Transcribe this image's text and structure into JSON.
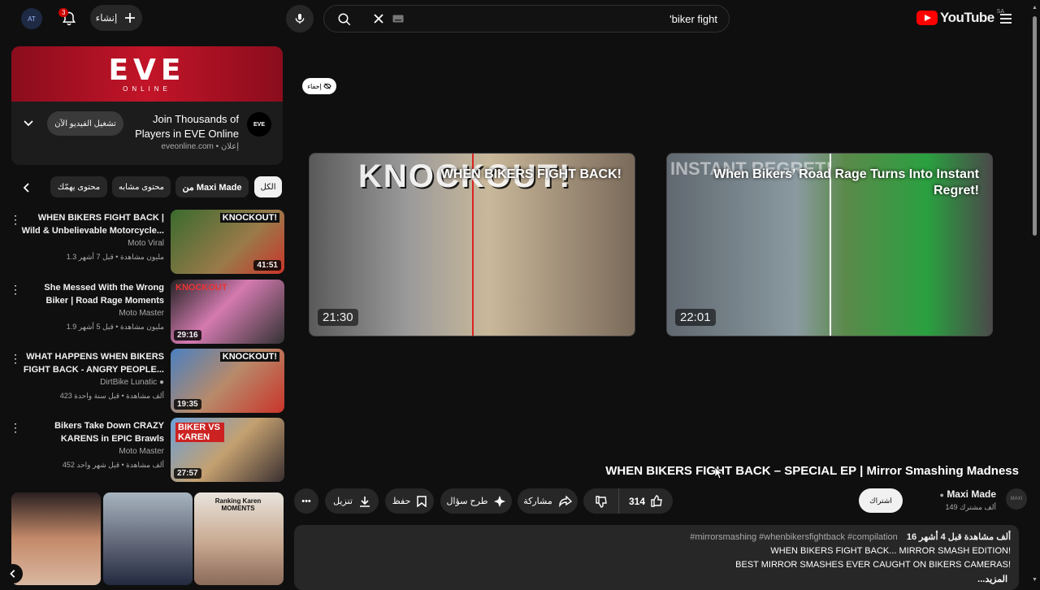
{
  "topbar": {
    "logo_text": "YouTube",
    "country_code": "SA",
    "search_query": "'biker fight",
    "create_label": "إنشاء",
    "notification_count": "3",
    "avatar_initials": "AT"
  },
  "ad": {
    "brand_logo": "EVE",
    "brand_logo_sub": "ONLINE",
    "title": "Join Thousands of Players in EVE Online",
    "ad_label": "إعلان",
    "domain": "eveonline.com",
    "cta_label": "تشغيل الفيديو الآن",
    "avatar_text": "EVE"
  },
  "chips": [
    "الكل",
    "من Maxi Made",
    "محتوى مشابه",
    "محتوى يهمّك"
  ],
  "related": [
    {
      "title": "WHEN BIKERS FIGHT BACK | Wild & Unbelievable Motorcycle...",
      "channel": "Moto Viral",
      "meta": "1.3 مليون مشاهدة • قبل 7 أشهر",
      "duration": "41:51",
      "thumb_text": "KNOCKOUT!"
    },
    {
      "title": "She Messed With the Wrong Biker | Road Rage Moments",
      "channel": "Moto Master",
      "meta": "1.9 مليون مشاهدة • قبل 5 أشهر",
      "duration": "29:16",
      "thumb_text": "KNOCKOUT"
    },
    {
      "title": "WHAT HAPPENS WHEN BIKERS FIGHT BACK - ANGRY PEOPLE...",
      "channel": "DirtBike Lunatic",
      "meta": "423 ألف مشاهدة • قبل سنة واحدة",
      "duration": "19:35",
      "thumb_text": "KNOCKOUT!"
    },
    {
      "title": "Bikers Take Down CRAZY KARENS in EPIC Brawls",
      "channel": "Moto Master",
      "meta": "452 ألف مشاهدة • قبل شهر واحد",
      "duration": "27:57",
      "thumb_text": "BIKER VS KAREN"
    }
  ],
  "shorts": [
    {
      "text": ""
    },
    {
      "text": ""
    },
    {
      "text": "Ranking Karen MOMENTS"
    }
  ],
  "endscreen": {
    "hide_label": "إخفاء",
    "cards": [
      {
        "title": "WHEN BIKERS FIGHT BACK!",
        "duration": "21:30",
        "thumb_text": "KNOCKOUT!"
      },
      {
        "title": "When Bikers’ Road Rage Turns Into Instant Regret!",
        "duration": "22:01",
        "thumb_text": "INSTANT REGRET!"
      }
    ]
  },
  "video": {
    "title": "WHEN BIKERS FIGHT BACK – SPECIAL EP | Mirror Smashing Madness",
    "channel": "Maxi Made",
    "subs": "149 ألف مشترك",
    "subscribe_label": "اشتراك",
    "likes": "314",
    "share_label": "مشاركة",
    "ask_label": "طرح سؤال",
    "save_label": "حفظ",
    "download_label": "تنزيل",
    "desc_views": "16 ألف مشاهدة  قبل 4 أشهر",
    "desc_tags": "#mirrorsmashing #whenbikersfightback #compilation",
    "desc_line2": "WHEN BIKERS FIGHT BACK... MIRROR SMASH EDITION!",
    "desc_line3": "BEST MIRROR SMASHES EVER CAUGHT ON BIKERS CAMERAS!",
    "desc_more": "...المزيد"
  },
  "colors": {
    "accent": "#ff0000",
    "bg": "#0f0f0f",
    "pill": "#272727",
    "ad_red": "#c31428"
  }
}
